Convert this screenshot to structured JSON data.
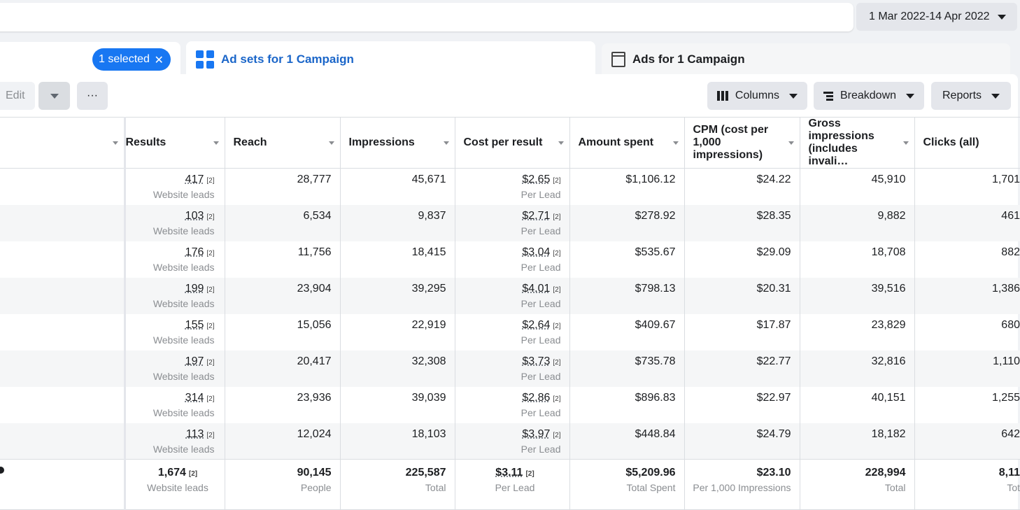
{
  "date_range": "1 Mar 2022-14 Apr 2022",
  "tabs": {
    "campaigns_selected": "1 selected",
    "adsets_label": "Ad sets for 1 Campaign",
    "ads_label": "Ads for 1 Campaign"
  },
  "toolbar": {
    "edit_label": "Edit",
    "more_label": "···",
    "columns_label": "Columns",
    "breakdown_label": "Breakdown",
    "reports_label": "Reports"
  },
  "table": {
    "headers": [
      "",
      "Results",
      "Reach",
      "Impressions",
      "Cost per result",
      "Amount spent",
      "CPM (cost per 1,000 impressions)",
      "Gross impressions (includes invali…",
      "Clicks (all)"
    ],
    "rows": [
      {
        "results": "417",
        "results_sub": "Website leads",
        "reach": "28,777",
        "impressions": "45,671",
        "cpr": "$2.65",
        "cpr_sub": "Per Lead",
        "spent": "$1,106.12",
        "cpm": "$24.22",
        "gross": "45,910",
        "clicks": "1,701"
      },
      {
        "results": "103",
        "results_sub": "Website leads",
        "reach": "6,534",
        "impressions": "9,837",
        "cpr": "$2.71",
        "cpr_sub": "Per Lead",
        "spent": "$278.92",
        "cpm": "$28.35",
        "gross": "9,882",
        "clicks": "461"
      },
      {
        "results": "176",
        "results_sub": "Website leads",
        "reach": "11,756",
        "impressions": "18,415",
        "cpr": "$3.04",
        "cpr_sub": "Per Lead",
        "spent": "$535.67",
        "cpm": "$29.09",
        "gross": "18,708",
        "clicks": "882"
      },
      {
        "results": "199",
        "results_sub": "Website leads",
        "reach": "23,904",
        "impressions": "39,295",
        "cpr": "$4.01",
        "cpr_sub": "Per Lead",
        "spent": "$798.13",
        "cpm": "$20.31",
        "gross": "39,516",
        "clicks": "1,386"
      },
      {
        "results": "155",
        "results_sub": "Website leads",
        "reach": "15,056",
        "impressions": "22,919",
        "cpr": "$2.64",
        "cpr_sub": "Per Lead",
        "spent": "$409.67",
        "cpm": "$17.87",
        "gross": "23,829",
        "clicks": "680"
      },
      {
        "results": "197",
        "results_sub": "Website leads",
        "reach": "20,417",
        "impressions": "32,308",
        "cpr": "$3.73",
        "cpr_sub": "Per Lead",
        "spent": "$735.78",
        "cpm": "$22.77",
        "gross": "32,816",
        "clicks": "1,110"
      },
      {
        "results": "314",
        "results_sub": "Website leads",
        "reach": "23,936",
        "impressions": "39,039",
        "cpr": "$2.86",
        "cpr_sub": "Per Lead",
        "spent": "$896.83",
        "cpm": "$22.97",
        "gross": "40,151",
        "clicks": "1,255"
      },
      {
        "results": "113",
        "results_sub": "Website leads",
        "reach": "12,024",
        "impressions": "18,103",
        "cpr": "$3.97",
        "cpr_sub": "Per Lead",
        "spent": "$448.84",
        "cpm": "$24.79",
        "gross": "18,182",
        "clicks": "642"
      }
    ],
    "footnote": "[2]",
    "totals": {
      "results": "1,674",
      "results_sub": "Website leads",
      "reach": "90,145",
      "reach_sub": "People",
      "impressions": "225,587",
      "impressions_sub": "Total",
      "cpr": "$3.11",
      "cpr_sub": "Per Lead",
      "spent": "$5,209.96",
      "spent_sub": "Total Spent",
      "cpm": "$23.10",
      "cpm_sub": "Per 1,000 Impressions",
      "gross": "228,994",
      "gross_sub": "Total",
      "clicks": "8,11",
      "clicks_sub": "Tot"
    }
  }
}
